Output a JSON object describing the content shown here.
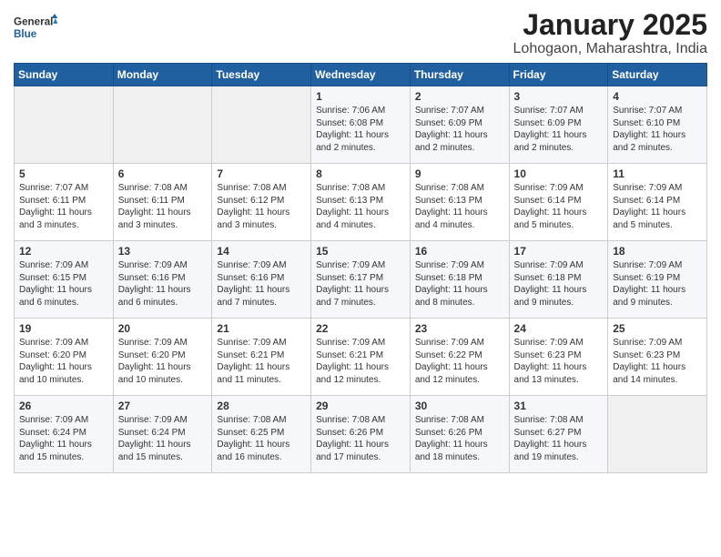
{
  "logo": {
    "general": "General",
    "blue": "Blue"
  },
  "title": "January 2025",
  "subtitle": "Lohogaon, Maharashtra, India",
  "days_of_week": [
    "Sunday",
    "Monday",
    "Tuesday",
    "Wednesday",
    "Thursday",
    "Friday",
    "Saturday"
  ],
  "weeks": [
    [
      {
        "num": "",
        "info": ""
      },
      {
        "num": "",
        "info": ""
      },
      {
        "num": "",
        "info": ""
      },
      {
        "num": "1",
        "info": "Sunrise: 7:06 AM\nSunset: 6:08 PM\nDaylight: 11 hours\nand 2 minutes."
      },
      {
        "num": "2",
        "info": "Sunrise: 7:07 AM\nSunset: 6:09 PM\nDaylight: 11 hours\nand 2 minutes."
      },
      {
        "num": "3",
        "info": "Sunrise: 7:07 AM\nSunset: 6:09 PM\nDaylight: 11 hours\nand 2 minutes."
      },
      {
        "num": "4",
        "info": "Sunrise: 7:07 AM\nSunset: 6:10 PM\nDaylight: 11 hours\nand 2 minutes."
      }
    ],
    [
      {
        "num": "5",
        "info": "Sunrise: 7:07 AM\nSunset: 6:11 PM\nDaylight: 11 hours\nand 3 minutes."
      },
      {
        "num": "6",
        "info": "Sunrise: 7:08 AM\nSunset: 6:11 PM\nDaylight: 11 hours\nand 3 minutes."
      },
      {
        "num": "7",
        "info": "Sunrise: 7:08 AM\nSunset: 6:12 PM\nDaylight: 11 hours\nand 3 minutes."
      },
      {
        "num": "8",
        "info": "Sunrise: 7:08 AM\nSunset: 6:13 PM\nDaylight: 11 hours\nand 4 minutes."
      },
      {
        "num": "9",
        "info": "Sunrise: 7:08 AM\nSunset: 6:13 PM\nDaylight: 11 hours\nand 4 minutes."
      },
      {
        "num": "10",
        "info": "Sunrise: 7:09 AM\nSunset: 6:14 PM\nDaylight: 11 hours\nand 5 minutes."
      },
      {
        "num": "11",
        "info": "Sunrise: 7:09 AM\nSunset: 6:14 PM\nDaylight: 11 hours\nand 5 minutes."
      }
    ],
    [
      {
        "num": "12",
        "info": "Sunrise: 7:09 AM\nSunset: 6:15 PM\nDaylight: 11 hours\nand 6 minutes."
      },
      {
        "num": "13",
        "info": "Sunrise: 7:09 AM\nSunset: 6:16 PM\nDaylight: 11 hours\nand 6 minutes."
      },
      {
        "num": "14",
        "info": "Sunrise: 7:09 AM\nSunset: 6:16 PM\nDaylight: 11 hours\nand 7 minutes."
      },
      {
        "num": "15",
        "info": "Sunrise: 7:09 AM\nSunset: 6:17 PM\nDaylight: 11 hours\nand 7 minutes."
      },
      {
        "num": "16",
        "info": "Sunrise: 7:09 AM\nSunset: 6:18 PM\nDaylight: 11 hours\nand 8 minutes."
      },
      {
        "num": "17",
        "info": "Sunrise: 7:09 AM\nSunset: 6:18 PM\nDaylight: 11 hours\nand 9 minutes."
      },
      {
        "num": "18",
        "info": "Sunrise: 7:09 AM\nSunset: 6:19 PM\nDaylight: 11 hours\nand 9 minutes."
      }
    ],
    [
      {
        "num": "19",
        "info": "Sunrise: 7:09 AM\nSunset: 6:20 PM\nDaylight: 11 hours\nand 10 minutes."
      },
      {
        "num": "20",
        "info": "Sunrise: 7:09 AM\nSunset: 6:20 PM\nDaylight: 11 hours\nand 10 minutes."
      },
      {
        "num": "21",
        "info": "Sunrise: 7:09 AM\nSunset: 6:21 PM\nDaylight: 11 hours\nand 11 minutes."
      },
      {
        "num": "22",
        "info": "Sunrise: 7:09 AM\nSunset: 6:21 PM\nDaylight: 11 hours\nand 12 minutes."
      },
      {
        "num": "23",
        "info": "Sunrise: 7:09 AM\nSunset: 6:22 PM\nDaylight: 11 hours\nand 12 minutes."
      },
      {
        "num": "24",
        "info": "Sunrise: 7:09 AM\nSunset: 6:23 PM\nDaylight: 11 hours\nand 13 minutes."
      },
      {
        "num": "25",
        "info": "Sunrise: 7:09 AM\nSunset: 6:23 PM\nDaylight: 11 hours\nand 14 minutes."
      }
    ],
    [
      {
        "num": "26",
        "info": "Sunrise: 7:09 AM\nSunset: 6:24 PM\nDaylight: 11 hours\nand 15 minutes."
      },
      {
        "num": "27",
        "info": "Sunrise: 7:09 AM\nSunset: 6:24 PM\nDaylight: 11 hours\nand 15 minutes."
      },
      {
        "num": "28",
        "info": "Sunrise: 7:08 AM\nSunset: 6:25 PM\nDaylight: 11 hours\nand 16 minutes."
      },
      {
        "num": "29",
        "info": "Sunrise: 7:08 AM\nSunset: 6:26 PM\nDaylight: 11 hours\nand 17 minutes."
      },
      {
        "num": "30",
        "info": "Sunrise: 7:08 AM\nSunset: 6:26 PM\nDaylight: 11 hours\nand 18 minutes."
      },
      {
        "num": "31",
        "info": "Sunrise: 7:08 AM\nSunset: 6:27 PM\nDaylight: 11 hours\nand 19 minutes."
      },
      {
        "num": "",
        "info": ""
      }
    ]
  ]
}
